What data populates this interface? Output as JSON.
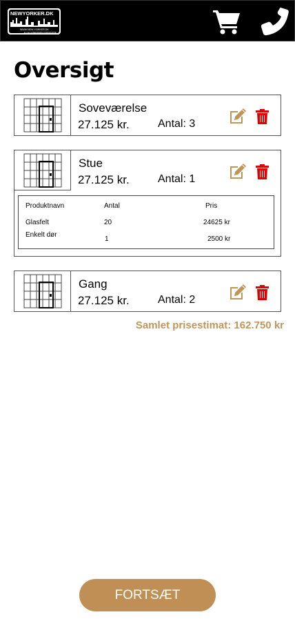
{
  "header": {
    "logo_text": "NEWYORKER.DK",
    "logo_subtext": "WWW.NEW-YORKER.DK",
    "logo_tagline": "- En del af BENDERS FORGRUPPE",
    "cart_icon": "shopping-cart-icon",
    "phone_icon": "phone-icon"
  },
  "page": {
    "title": "Oversigt"
  },
  "items": [
    {
      "name": "Soveværelse",
      "price": "27.125 kr.",
      "qty": "Antal: 3"
    },
    {
      "name": "Stue",
      "price": "27.125 kr.",
      "qty": "Antal: 1",
      "details": {
        "headers": [
          "Produktnavn",
          "Antal",
          "Pris"
        ],
        "rows": [
          [
            "Glasfelt",
            "20",
            "24625 kr"
          ],
          [
            "Enkelt dør",
            "1",
            "2500 kr"
          ]
        ]
      }
    },
    {
      "name": "Gang",
      "price": "27.125 kr.",
      "qty": "Antal: 2"
    }
  ],
  "summary": {
    "total": "Samlet prisestimat: 162.750 kr"
  },
  "footer": {
    "continue_label": "FORTSÆT"
  },
  "colors": {
    "accent": "#bf8f55",
    "total_text": "#c0955a",
    "delete": "#e00000",
    "edit": "#c0955a"
  }
}
